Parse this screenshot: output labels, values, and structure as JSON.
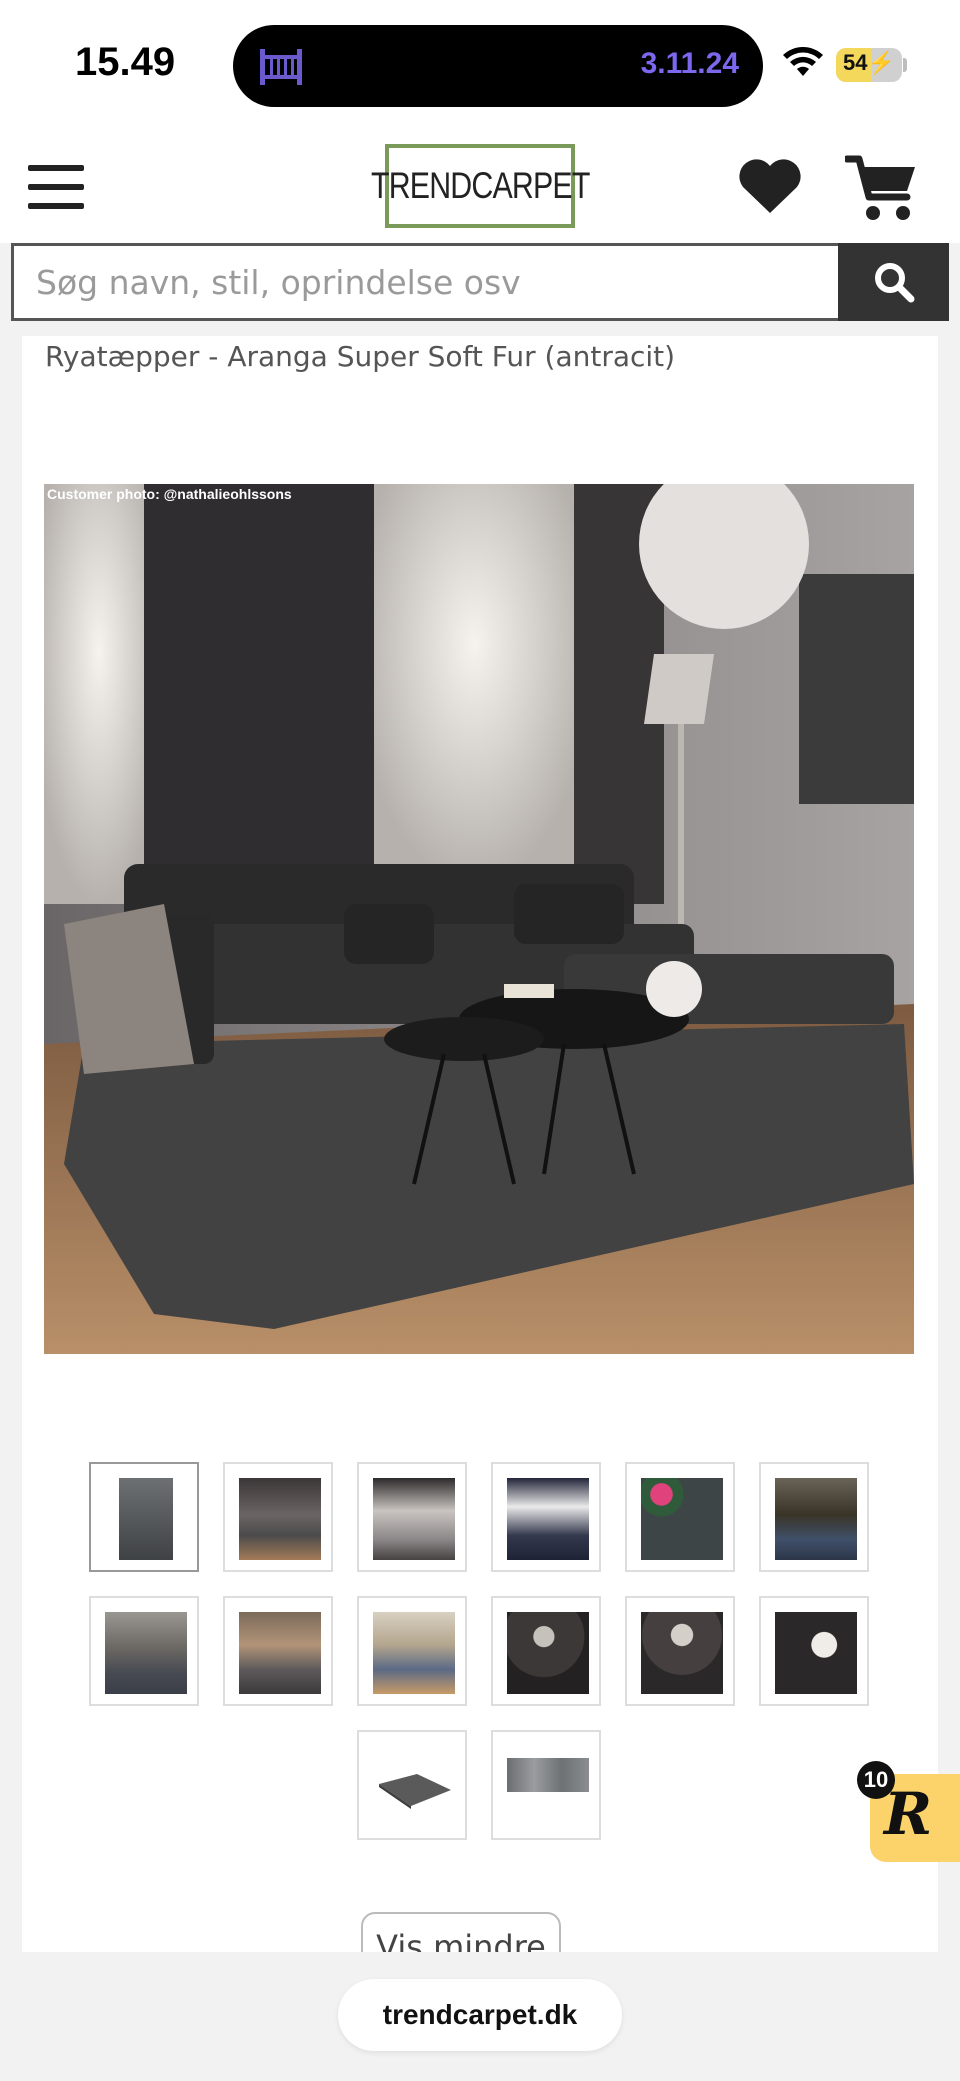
{
  "status_bar": {
    "time": "15.49",
    "island_date": "3.11.24",
    "battery_level": "54",
    "battery_fraction": 0.54
  },
  "header": {
    "logo_text": "TRENDCARPET",
    "menu_icon": "hamburger-menu-icon",
    "wishlist_icon": "heart-icon",
    "cart_icon": "shopping-cart-icon"
  },
  "search": {
    "placeholder": "Søg navn, stil, oprindelse osv",
    "button_icon": "search-icon"
  },
  "product": {
    "title": "Ryatæpper - Aranga Super Soft Fur (antracit)",
    "photo_credit": "Customer photo: @nathalieohlssons"
  },
  "gallery": {
    "thumbnail_count": 14,
    "active_index": 0
  },
  "show_less_label": "Vis mindre",
  "widget": {
    "letter": "R",
    "count": "10"
  },
  "browser": {
    "url": "trendcarpet.dk"
  }
}
